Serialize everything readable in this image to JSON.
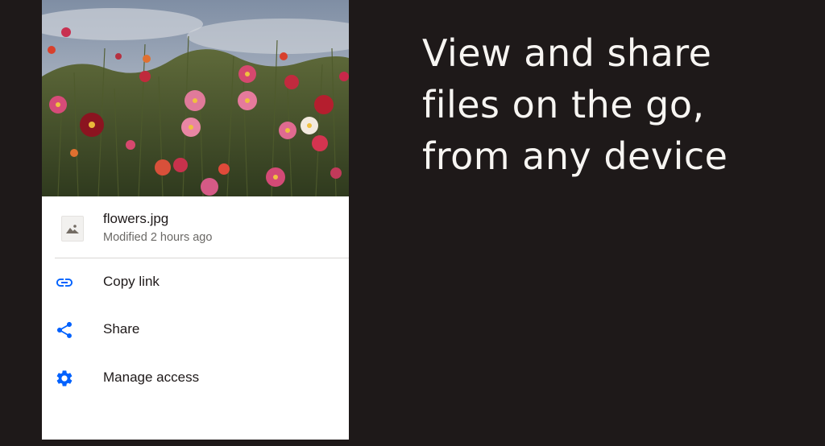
{
  "file": {
    "name": "flowers.jpg",
    "modified": "Modified 2 hours ago"
  },
  "menu": {
    "items": [
      {
        "label": "Copy link",
        "icon": "link-icon"
      },
      {
        "label": "Share",
        "icon": "share-icon"
      },
      {
        "label": "Manage access",
        "icon": "gear-icon"
      }
    ]
  },
  "headline": {
    "lines": [
      "View and share",
      "files on the go,",
      "from any device"
    ]
  },
  "colors": {
    "background": "#1e1919",
    "accent": "#0061fe",
    "headline": "#f7f5f2",
    "card": "#ffffff"
  }
}
